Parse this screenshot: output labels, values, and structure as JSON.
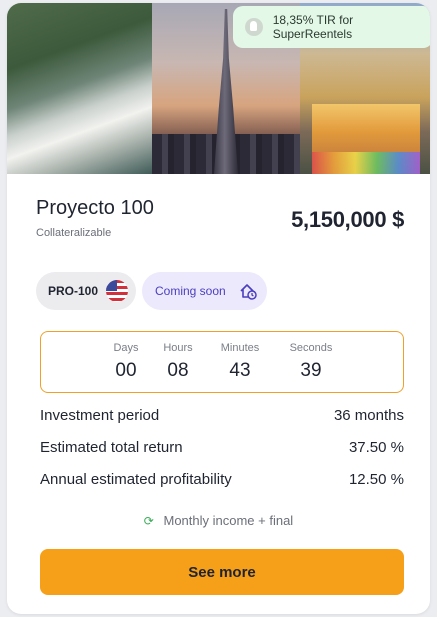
{
  "badge": {
    "text": "18,35% TIR for SuperReentels",
    "icon": "coin-icon"
  },
  "project": {
    "title": "Proyecto 100",
    "subtitle": "Collateralizable",
    "amount": "5,150,000 $"
  },
  "tags": {
    "code": "PRO-100",
    "status": "Coming soon",
    "flag_icon": "us-flag-icon",
    "status_icon": "house-clock-icon"
  },
  "countdown": {
    "days_label": "Days",
    "days": "00",
    "hours_label": "Hours",
    "hours": "08",
    "minutes_label": "Minutes",
    "minutes": "43",
    "seconds_label": "Seconds",
    "seconds": "39"
  },
  "details": [
    {
      "label": "Investment period",
      "value": "36 months"
    },
    {
      "label": "Estimated total return",
      "value": "37.50 %"
    },
    {
      "label": "Annual estimated profitability",
      "value": "12.50 %"
    }
  ],
  "income": {
    "text": "Monthly income + final",
    "icon": "recycle-icon"
  },
  "cta": {
    "label": "See more"
  },
  "colors": {
    "accent": "#f6a019",
    "badge_bg": "#e4f8e8",
    "soon_bg": "#ebe9fb",
    "soon_text": "#4b3fc0"
  }
}
